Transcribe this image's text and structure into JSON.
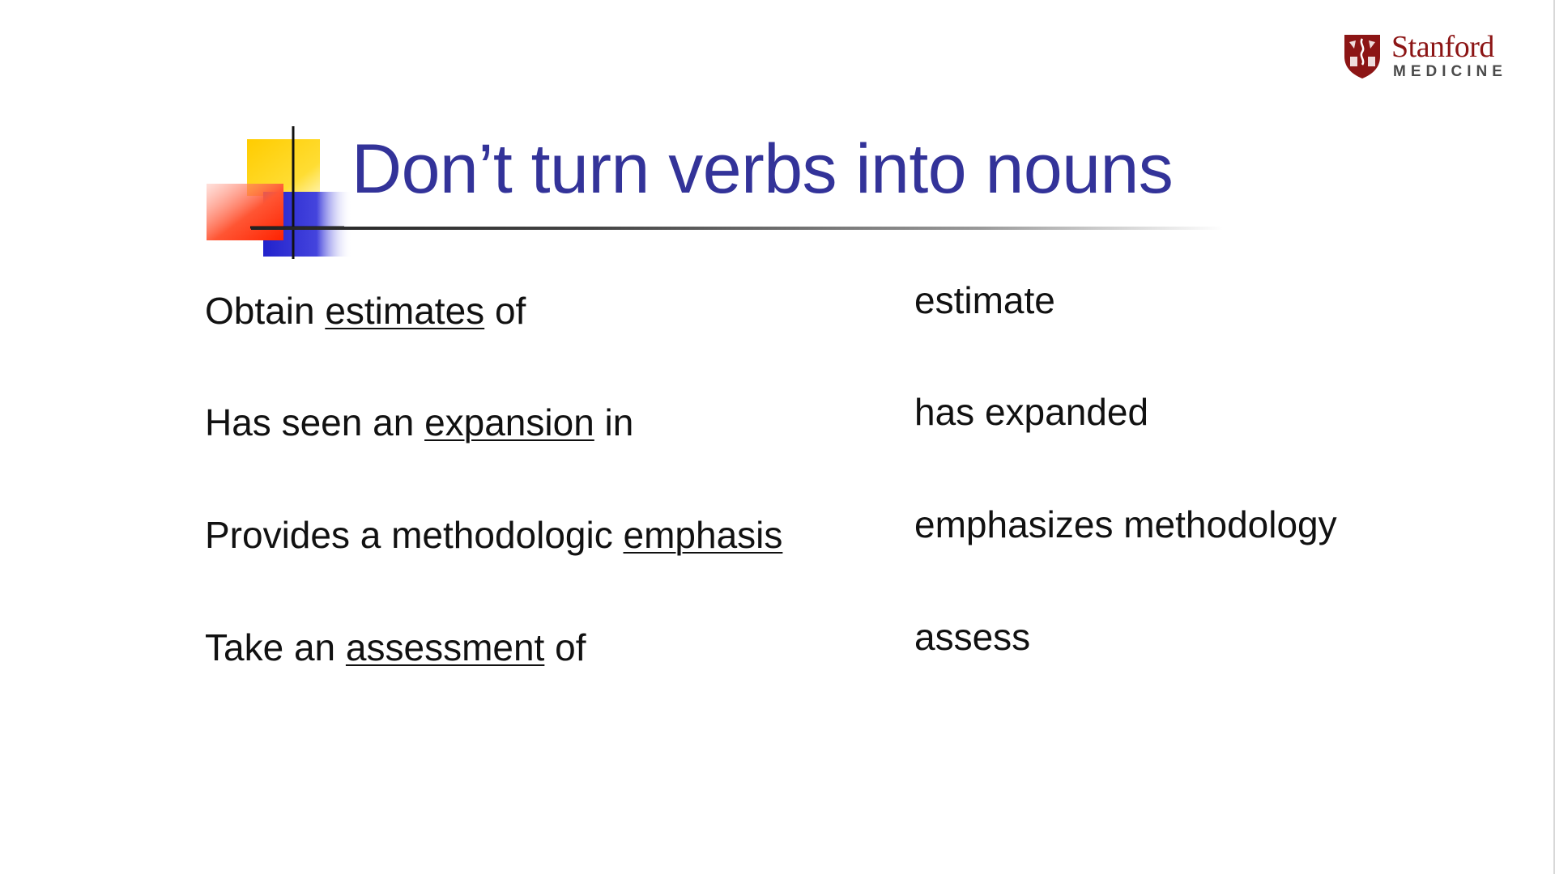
{
  "logo": {
    "wordmark": "Stanford",
    "subtitle": "MEDICINE",
    "brand_color": "#8c1515"
  },
  "title": {
    "text": "Don’t turn verbs into nouns",
    "color": "#333399"
  },
  "ornament": {
    "colors": [
      "#ffcc00",
      "#3333cc",
      "#ff3300",
      "#000000"
    ]
  },
  "rows": [
    {
      "before": "Obtain ",
      "noun": "estimates",
      "after": " of",
      "replacement": "estimate"
    },
    {
      "before": "Has seen an ",
      "noun": "expansion",
      "after": " in",
      "replacement": "has expanded"
    },
    {
      "before": "Provides a methodologic ",
      "noun": "emphasis",
      "after": "",
      "replacement": "emphasizes methodology"
    },
    {
      "before": "Take an ",
      "noun": "assessment",
      "after": " of",
      "replacement": "assess"
    }
  ]
}
